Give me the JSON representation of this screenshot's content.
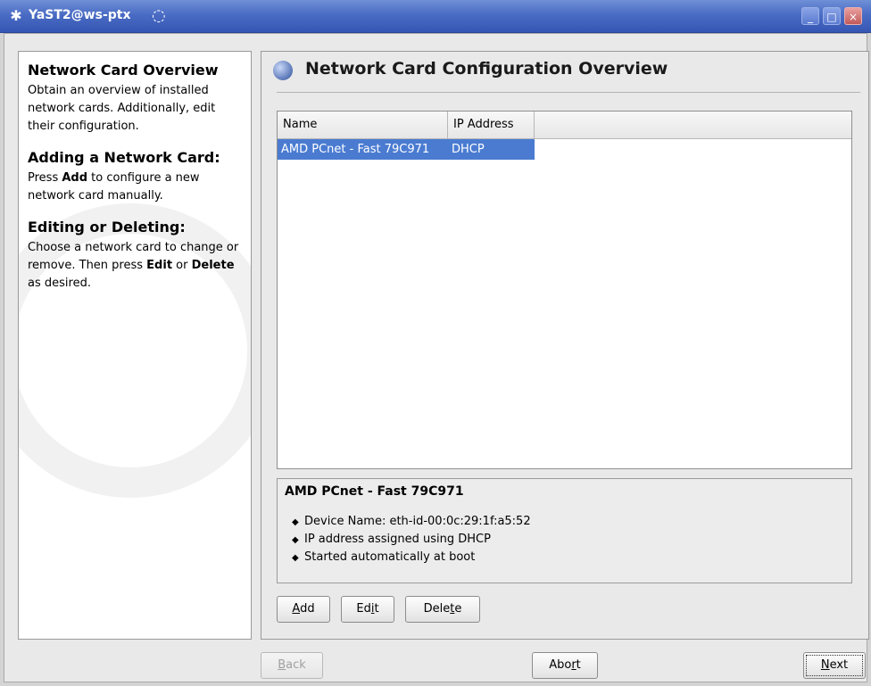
{
  "window": {
    "title": "YaST2@ws-ptx",
    "controls": {
      "minimize": "_",
      "maximize": "□",
      "close": "×"
    }
  },
  "help": {
    "sections": [
      {
        "heading": "Network Card Overview",
        "text": "Obtain an overview of installed network cards. Additionally, edit their configuration."
      },
      {
        "heading": "Adding a Network Card:",
        "text_before": "Press ",
        "bold": "Add",
        "text_after": " to configure a new network card manually."
      },
      {
        "heading": "Editing or Deleting:",
        "text_before": "Choose a network card to change or remove. Then press ",
        "bold1": "Edit",
        "middle": " or ",
        "bold2": "Delete",
        "text_after": " as desired."
      }
    ]
  },
  "main": {
    "title": "Network Card Configuration Overview",
    "table": {
      "columns": [
        "Name",
        "IP Address"
      ],
      "rows": [
        {
          "name": "AMD PCnet - Fast 79C971",
          "ip": "DHCP",
          "selected": true
        }
      ]
    },
    "details": {
      "title": "AMD PCnet - Fast 79C971",
      "items": [
        "Device Name: eth-id-00:0c:29:1f:a5:52",
        "IP address assigned using DHCP",
        "Started automatically at boot"
      ]
    },
    "buttons": {
      "add": {
        "pre": "",
        "mnemonic": "A",
        "post": "dd"
      },
      "edit": {
        "pre": "Ed",
        "mnemonic": "i",
        "post": "t"
      },
      "delete": {
        "pre": "Dele",
        "mnemonic": "t",
        "post": "e"
      }
    }
  },
  "footer": {
    "back": {
      "pre": "",
      "mnemonic": "B",
      "post": "ack",
      "enabled": false
    },
    "abort": {
      "pre": "Abo",
      "mnemonic": "r",
      "post": "t"
    },
    "next": {
      "pre": "",
      "mnemonic": "N",
      "post": "ext"
    }
  },
  "colors": {
    "titlebar": "#4a6cc4",
    "selection": "#4a7bd1"
  }
}
